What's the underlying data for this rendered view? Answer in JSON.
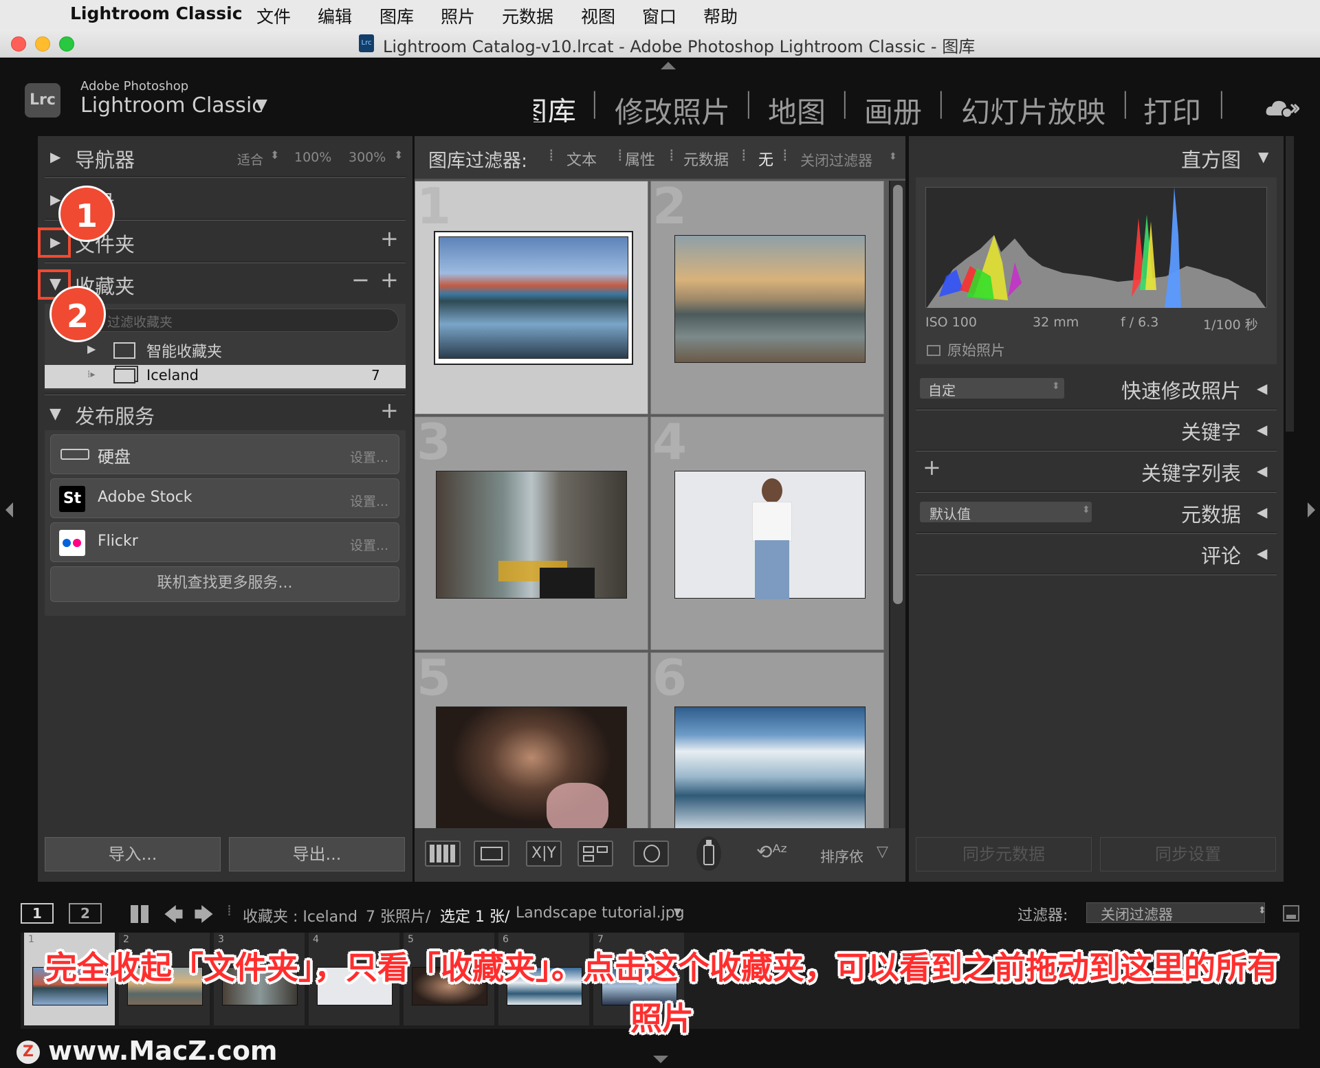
{
  "menubar": {
    "app_name": "Lightroom Classic",
    "items": [
      "文件",
      "编辑",
      "图库",
      "照片",
      "元数据",
      "视图",
      "窗口",
      "帮助"
    ]
  },
  "window": {
    "title": "Lightroom Catalog-v10.lrcat - Adobe Photoshop Lightroom Classic - 图库"
  },
  "identity": {
    "logo": "Lrc",
    "brand_top": "Adobe Photoshop",
    "brand_main": "Lightroom Classic",
    "modules": [
      "图库",
      "修改照片",
      "地图",
      "画册",
      "幻灯片放映",
      "打印"
    ],
    "active_module": "图库"
  },
  "left_panel": {
    "navigator": {
      "title": "导航器",
      "zoom_fit": "适合",
      "zoom_100": "100%",
      "zoom_300": "300%"
    },
    "catalog": {
      "title": "目录"
    },
    "folders": {
      "title": "文件夹",
      "add": "+"
    },
    "collections": {
      "title": "收藏夹",
      "minus": "−",
      "add": "+",
      "filter_placeholder": "过滤收藏夹",
      "smart_collections": "智能收藏夹",
      "items": [
        {
          "name": "Iceland",
          "count": "7"
        }
      ]
    },
    "publish": {
      "title": "发布服务",
      "add": "+",
      "services": [
        {
          "name": "硬盘",
          "setup": "设置..."
        },
        {
          "name": "Adobe Stock",
          "setup": "设置...",
          "icon_text": "St"
        },
        {
          "name": "Flickr",
          "setup": "设置..."
        }
      ],
      "more": "联机查找更多服务..."
    },
    "import_label": "导入...",
    "export_label": "导出..."
  },
  "filter_bar": {
    "label": "图库过滤器:",
    "tabs": [
      "文本",
      "属性",
      "元数据",
      "无"
    ],
    "active": "无",
    "preset": "关闭过滤器"
  },
  "grid": {
    "cell_numbers": [
      "1",
      "2",
      "3",
      "4",
      "5",
      "6"
    ],
    "selected_index": 0
  },
  "toolbar": {
    "sort_label": "排序依"
  },
  "right_panel": {
    "histogram": {
      "title": "直方图",
      "iso": "ISO 100",
      "focal": "32 mm",
      "aperture": "f / 6.3",
      "shutter": "1/100 秒",
      "original_photo": "原始照片"
    },
    "quick_develop": {
      "preset": "自定",
      "title": "快速修改照片"
    },
    "keywording": {
      "title": "关键字"
    },
    "keyword_list": {
      "title": "关键字列表",
      "add": "+"
    },
    "metadata": {
      "preset": "默认值",
      "title": "元数据"
    },
    "comments": {
      "title": "评论"
    },
    "sync_metadata": "同步元数据",
    "sync_settings": "同步设置"
  },
  "filmstrip_bar": {
    "screen1": "1",
    "screen2": "2",
    "source": "收藏夹 : Iceland",
    "count": "7 张照片/",
    "selected": "选定 1 张/",
    "filename": "Landscape tutorial.jpg",
    "filter_label": "过滤器:",
    "filter_value": "关闭过滤器"
  },
  "filmstrip": {
    "numbers": [
      "1",
      "2",
      "3",
      "4",
      "5",
      "6",
      "7"
    ]
  },
  "annotations": {
    "badge1": "1",
    "badge2": "2",
    "caption_line1": "完全收起「文件夹」，只看「收藏夹」。点击这个收藏夹，可以看到之前拖动到这里的所有",
    "caption_line2": "照片",
    "watermark": "www.MacZ.com"
  },
  "colors": {
    "annotation_red": "#f04a32",
    "caption_red": "#ff2e2e",
    "panel_bg": "#313131",
    "grid_bg": "#5e5e5e"
  }
}
